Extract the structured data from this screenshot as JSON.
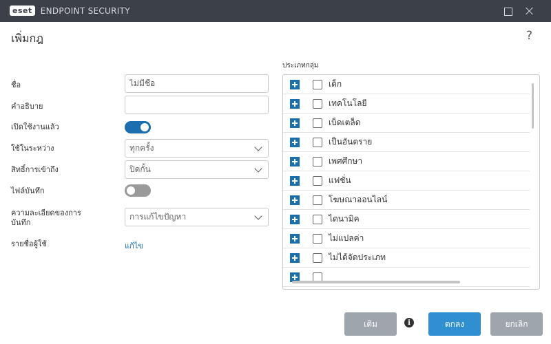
{
  "window": {
    "logo_text": "eset",
    "app_title": "ENDPOINT SECURITY"
  },
  "page": {
    "title": "เพิ่มกฎ",
    "help": "?"
  },
  "form": {
    "name_label": "ชื่อ",
    "name_value": "ไม่มีชื่อ",
    "description_label": "คำอธิบาย",
    "description_value": "",
    "enabled_label": "เปิดใช้งานแล้ว",
    "enabled": true,
    "apply_during_label": "ใช้ในระหว่าง",
    "apply_during_value": "ทุกครั้ง",
    "access_rights_label": "สิทธิ์การเข้าถึง",
    "access_rights_value": "ปิดกั้น",
    "log_label": "ไฟล์บันทึก",
    "log_enabled": false,
    "log_severity_label": "ความละเอียดของการบันทึก",
    "log_severity_value": "การแก้ไขปัญหา",
    "user_list_label": "รายชื่อผู้ใช้",
    "user_list_link": "แก้ไข"
  },
  "categories": {
    "heading": "ประเภทกลุ่ม",
    "items": [
      {
        "label": "เด็ก",
        "checked": false
      },
      {
        "label": "เทคโนโลยี",
        "checked": false
      },
      {
        "label": "เบ็ดเตล็ด",
        "checked": false
      },
      {
        "label": "เป็นอันตราย",
        "checked": false
      },
      {
        "label": "เพศศึกษา",
        "checked": false
      },
      {
        "label": "แฟชั่น",
        "checked": false
      },
      {
        "label": "โฆษณาออนไลน์",
        "checked": false
      },
      {
        "label": "ไดนามิค",
        "checked": false
      },
      {
        "label": "ไม่แปลค่า",
        "checked": false
      },
      {
        "label": "ไม่ได้จัดประเภท",
        "checked": false
      },
      {
        "label": "",
        "checked": false
      }
    ]
  },
  "buttons": {
    "add": "เติม",
    "ok": "ตกลง",
    "cancel": "ยกเลิก"
  },
  "colors": {
    "titlebar": "#3c4048",
    "accent": "#1c6fae",
    "primary_button": "#2f8fd0",
    "secondary_button": "#9ea5ad"
  }
}
